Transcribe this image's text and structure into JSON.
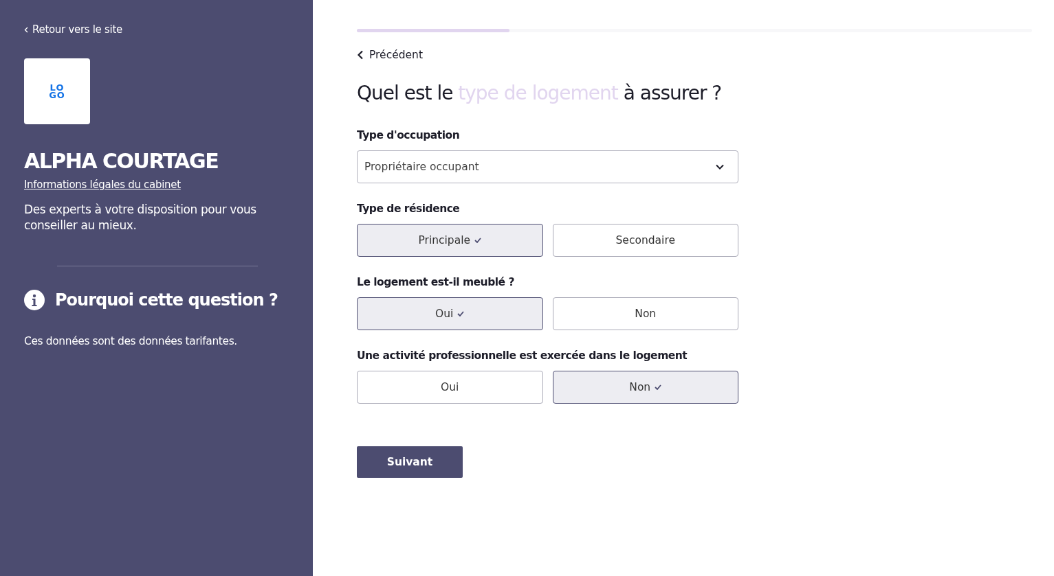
{
  "sidebar": {
    "back_link": "Retour vers le site",
    "logo_lines": [
      "LO",
      "GO"
    ],
    "company": "ALPHA COURTAGE",
    "legal_link": "Informations légales du cabinet",
    "tagline": "Des experts à votre disposition pour vous conseiller au mieux.",
    "info_title": "Pourquoi cette question ?",
    "info_text": "Ces données sont des données tarifantes."
  },
  "progress": {
    "level": 0.226
  },
  "previous": "Précédent",
  "question": {
    "before": "Quel est le",
    "highlight": "type de logement",
    "after": "à assurer ?"
  },
  "fields": [
    {
      "kind": "select",
      "label": "Type d'occupation",
      "value": "Propriétaire occupant"
    },
    {
      "kind": "choice",
      "label": "Type de résidence",
      "options": [
        {
          "label": "Principale",
          "selected": true
        },
        {
          "label": "Secondaire",
          "selected": false
        }
      ]
    },
    {
      "kind": "choice",
      "label": "Le logement est-il meublé ?",
      "options": [
        {
          "label": "Oui",
          "selected": true
        },
        {
          "label": "Non",
          "selected": false
        }
      ]
    },
    {
      "kind": "choice",
      "label": "Une activité professionnelle est exercée dans le logement",
      "options": [
        {
          "label": "Oui",
          "selected": false
        },
        {
          "label": "Non",
          "selected": true
        }
      ]
    }
  ],
  "next_button": "Suivant"
}
